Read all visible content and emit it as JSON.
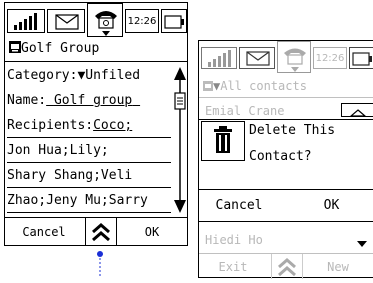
{
  "left": {
    "status": {
      "time": "12:26"
    },
    "title": "Golf Group",
    "category_label": "Category:",
    "category_value": "Unfiled",
    "name_label": "Name:",
    "name_value": "Golf group",
    "recipients_label": "Recipients:",
    "recipients_lines": [
      "Coco;",
      "Jon Hua;Lily;",
      "Shary Shang;Veli",
      "Zhao;Jeny Mu;Sarry"
    ],
    "cancel": "Cancel",
    "ok": "OK"
  },
  "right": {
    "status": {
      "time": "12:26"
    },
    "category": "All contacts",
    "list_top": "Emial Crane",
    "dialog_line1": "Delete This",
    "dialog_line2": "Contact?",
    "cancel": "Cancel",
    "ok": "OK",
    "list_bottom": "Hiedi Ho",
    "exit": "Exit",
    "new": "New"
  },
  "colors": {
    "accent_dot": "#1a2fd6",
    "dim_text": "#b8b8b8"
  }
}
